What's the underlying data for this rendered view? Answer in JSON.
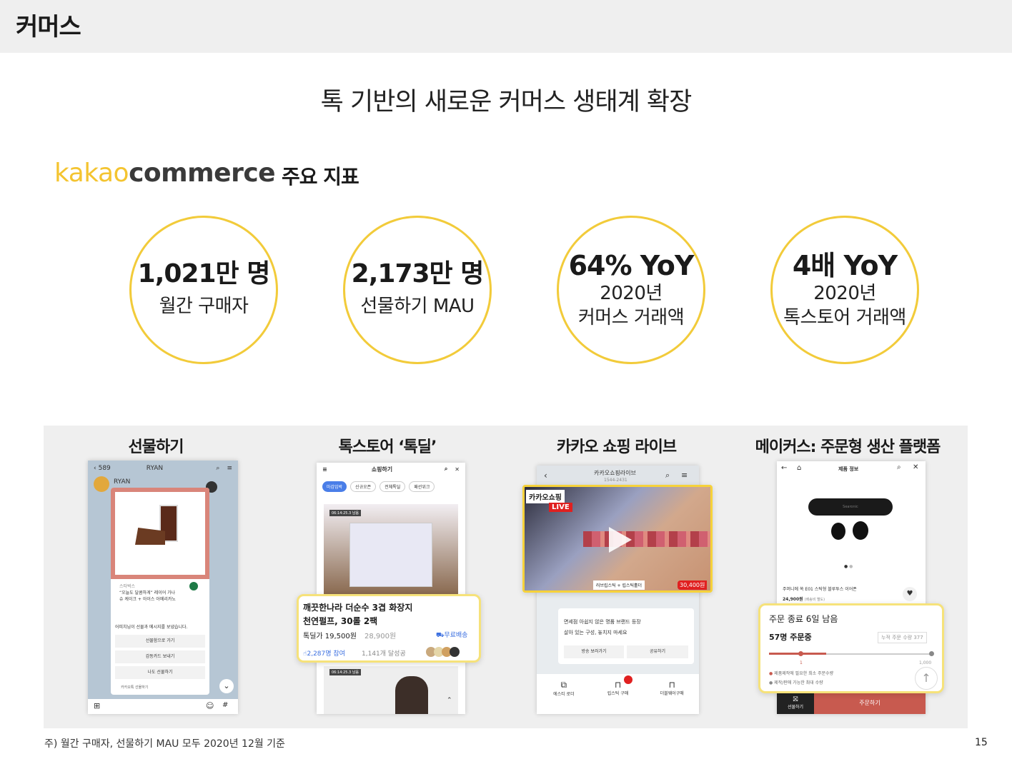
{
  "header": {
    "title": "커머스"
  },
  "headline": "톡 기반의 새로운 커머스 생태계 확장",
  "brand": {
    "kakao": "kakao",
    "commerce": "commerce"
  },
  "indicators_label": "주요 지표",
  "metrics": [
    {
      "value": "1,021만 명",
      "line1": "월간 구매자",
      "line2": ""
    },
    {
      "value": "2,173만 명",
      "line1": "선물하기 MAU",
      "line2": ""
    },
    {
      "value": "64% YoY",
      "line1": "2020년",
      "line2": "커머스 거래액"
    },
    {
      "value": "4배 YoY",
      "line1": "2020년",
      "line2": "톡스토어 거래액"
    }
  ],
  "gallery": {
    "titles": [
      "선물하기",
      "톡스토어 ‘톡딜’",
      "카카오 쇼핑 라이브",
      "메이커스: 주문형 생산 플랫폼"
    ],
    "gift": {
      "back_count": "589",
      "chat_name": "RYAN",
      "sender": "RYAN",
      "brand": "스타벅스",
      "msg1": "“오늘도 달콤하게” 레이어 가나",
      "msg2": "슈 케이크 + 아이스 아메리카노",
      "notice": "어피치님이 선물과 메시지를 보냈습니다.",
      "btn1": "선물함으로 가기",
      "btn2": "감동카드 보내기",
      "btn3": "나도 선물하기",
      "footer": "카카오톡 선물하기"
    },
    "talkdeal": {
      "header": "쇼핑하기",
      "tabs": [
        "마감임박",
        "신규오픈",
        "전체톡딜",
        "패션위크"
      ],
      "timer1": "06:14:25.3 남음",
      "timer2": "06:14:25.3 남음",
      "product_title1": "깨끗한나라 더순수 3겹 화장지",
      "product_title2": "천연펄프, 30롤 2팩",
      "price_label": "톡딜가 19,500원",
      "orig_price": "28,900원",
      "shipping": "무료배송",
      "participants": "2,287명 참여",
      "achieved": "1,141개 달성공"
    },
    "live": {
      "header": "카카오쇼핑라이브",
      "phone": "1544-2431",
      "badge_brand": "카카오쇼핑",
      "badge_live": "LIVE",
      "product_label": "러브립스틱 + 립스틱홀더",
      "product_price": "30,400원",
      "desc1": "면세점 아쉽지 않은 명품 브랜드 등장",
      "desc2": "살아 있는 구성, 놓치지 마세요",
      "btn1": "방송 보러가기",
      "btn2": "공유하기",
      "nav": [
        "에스티 로더",
        "립스틱 구매",
        "더블웨어구매"
      ]
    },
    "makers": {
      "header": "제품 정보",
      "product_brand": "Searonic",
      "product_title": "주머니에 쏙 E01 스틱형 블루투스 이어폰",
      "product_price": "24,900원",
      "product_price_note": "(배송비 별도)",
      "deadline": "주문 종료 6일 남음",
      "ordering": "57명 주문중",
      "cumulative": "누적 주문 수량 377",
      "min_value": "1",
      "max_value": "1,000",
      "legend1": "제품제작에 필요한 최소 주문수량",
      "legend2": "제작/판매 가능한 최대 수량",
      "gift_btn": "선물하기",
      "order_btn": "주문하기"
    }
  },
  "footnote": "주) 월간 구매자, 선물하기 MAU 모두 2020년 12월 기준",
  "page_number": "15",
  "colors": {
    "accent_yellow": "#f2cb3a",
    "talk_yellow": "#fae100",
    "makers_red": "#c85a4f",
    "live_red": "#e02020"
  }
}
